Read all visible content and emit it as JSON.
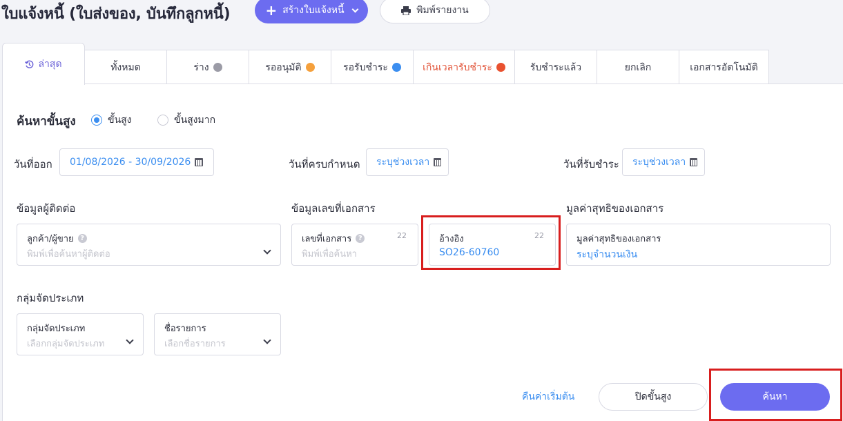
{
  "header": {
    "title": "ใบแจ้งหนี้ (ใบส่งของ, บันทึกลูกหนี้)",
    "create_button": "สร้างใบแจ้งหนี้",
    "create_icon": "plus-icon",
    "print_button": "พิมพ์รายงาน",
    "print_icon": "printer-icon"
  },
  "tabs": [
    {
      "label": "ล่าสุด",
      "icon": "history-icon",
      "active": true
    },
    {
      "label": "ทั้งหมด"
    },
    {
      "label": "ร่าง",
      "dot_color": "#9b9ba6"
    },
    {
      "label": "รออนุมัติ",
      "dot_color": "#f5a03c"
    },
    {
      "label": "รอรับชำระ",
      "dot_color": "#3b8ef0"
    },
    {
      "label": "เกินเวลารับชำระ",
      "dot_color": "#e9512f",
      "color": "#e2553a"
    },
    {
      "label": "รับชำระแล้ว"
    },
    {
      "label": "ยกเลิก"
    },
    {
      "label": "เอกสารอัตโนมัติ"
    }
  ],
  "search": {
    "heading": "ค้นหาขั้นสูง",
    "mode_advanced": "ขั้นสูง",
    "mode_very_advanced": "ขั้นสูงมาก",
    "selected_mode": "ขั้นสูง",
    "issue_date_label": "วันที่ออก",
    "issue_date_value": "01/08/2026 - 30/09/2026",
    "due_date_label": "วันที่ครบกำหนด",
    "due_date_value": "ระบุช่วงเวลา",
    "payment_date_label": "วันที่รับชำระ",
    "payment_date_value": "ระบุช่วงเวลา",
    "contact_section": "ข้อมูลผู้ติดต่อ",
    "doc_section": "ข้อมูลเลขที่เอกสาร",
    "net_section": "มูลค่าสุทธิของเอกสาร",
    "customer_label": "ลูกค้า/ผู้ขาย",
    "customer_placeholder": "พิมพ์เพื่อค้นหาผู้ติดต่อ",
    "docno_label": "เลขที่เอกสาร",
    "docno_placeholder": "พิมพ์เพื่อค้นหา",
    "docno_count": "22",
    "ref_label": "อ้างอิง",
    "ref_value": "SO26-60760",
    "ref_count": "22",
    "net_label": "มูลค่าสุทธิของเอกสาร",
    "net_placeholder": "ระบุจำนวนเงิน",
    "category_section": "กลุ่มจัดประเภท",
    "group_label": "กลุ่มจัดประเภท",
    "group_placeholder": "เลือกกลุ่มจัดประเภท",
    "item_label": "ชื่อรายการ",
    "item_placeholder": "เลือกชื่อรายการ",
    "reset_link": "คืนค่าเริ่มต้น",
    "close_button": "ปิดขั้นสูง",
    "search_button": "ค้นหา"
  }
}
